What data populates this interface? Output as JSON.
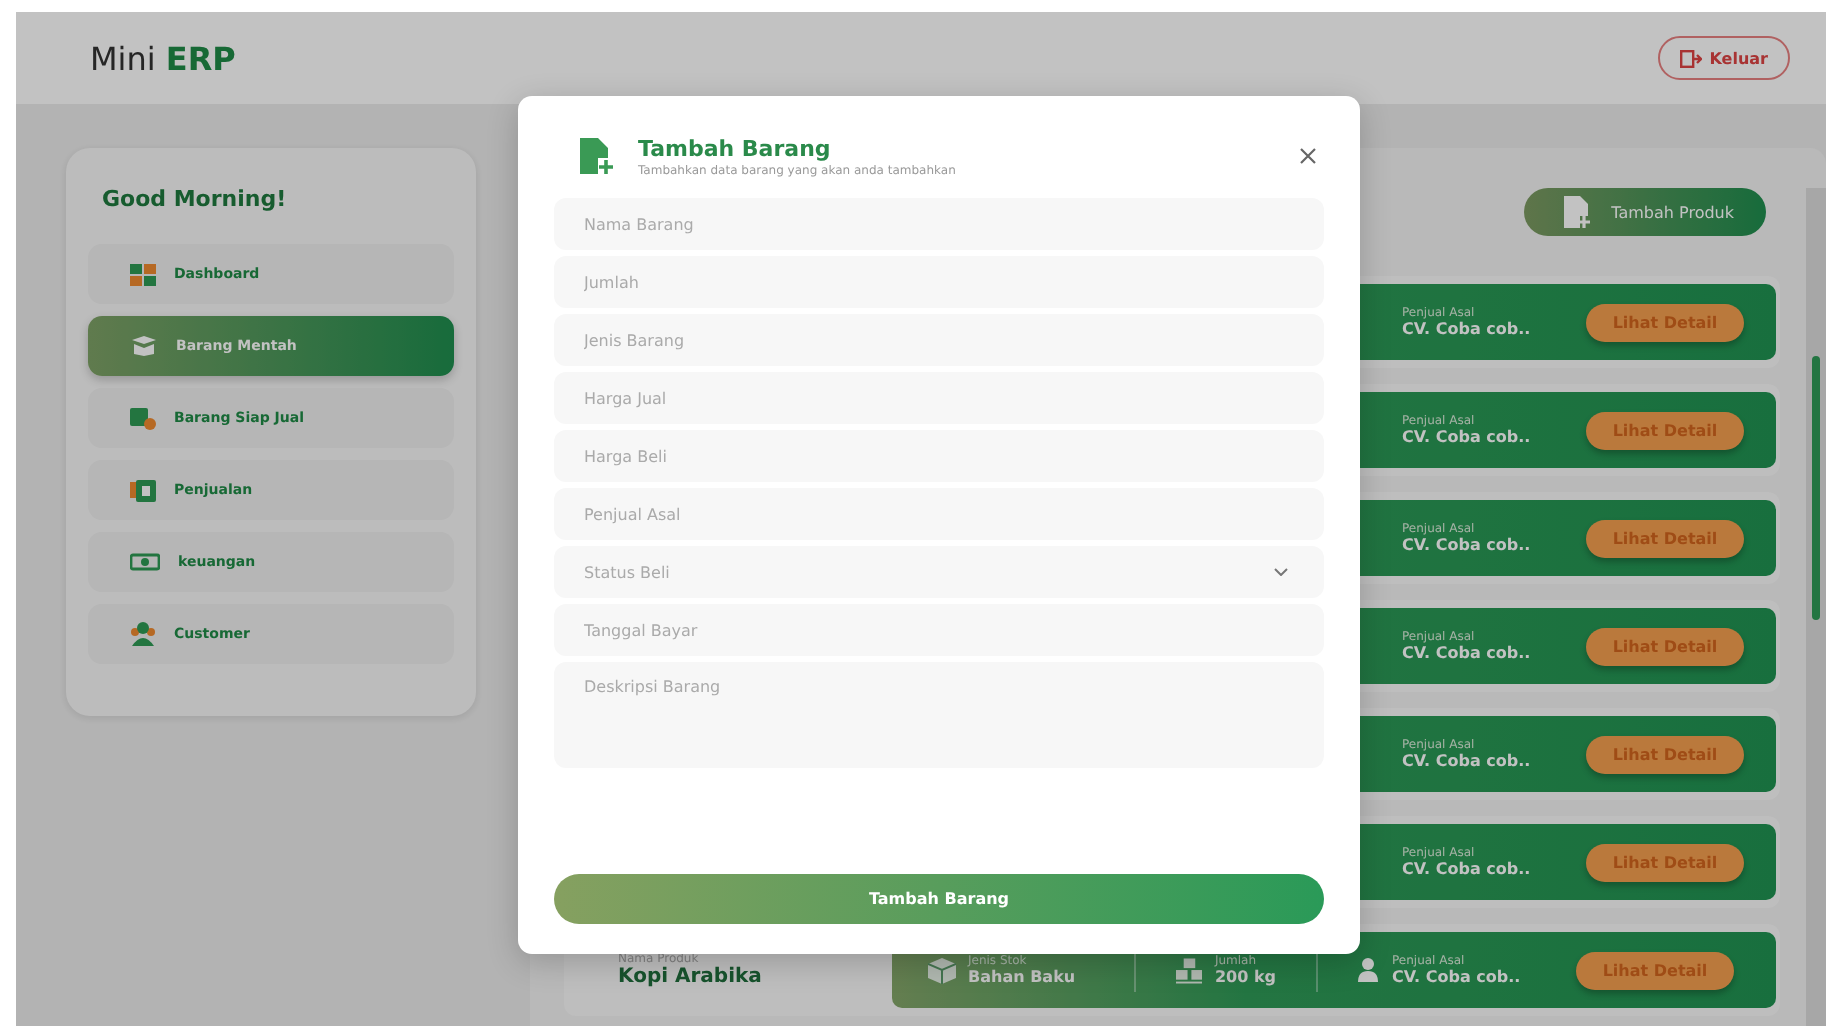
{
  "header": {
    "brand": "Mini **ERP**",
    "logout_button": "Keluar"
  },
  "sidebar": {
    "greeting": "Good Morning!",
    "items": [
      {
        "label": "Dashboard",
        "selected": false
      },
      {
        "label": "Barang Mentah",
        "selected": true
      },
      {
        "label": "Barang Siap Jual",
        "selected": false
      },
      {
        "label": "Penjualan",
        "selected": false
      },
      {
        "label": "keuangan",
        "selected": false
      },
      {
        "label": "Customer",
        "selected": false
      }
    ]
  },
  "main": {
    "add_button": "Tambah Produk",
    "products": [
      {
        "seller_label": "Penjual Asal",
        "seller": "CV. Coba cob..",
        "detail_button": "Lihat Detail"
      },
      {
        "seller_label": "Penjual Asal",
        "seller": "CV. Coba cob..",
        "detail_button": "Lihat Detail"
      },
      {
        "seller_label": "Penjual Asal",
        "seller": "CV. Coba cob..",
        "detail_button": "Lihat Detail"
      },
      {
        "seller_label": "Penjual Asal",
        "seller": "CV. Coba cob..",
        "detail_button": "Lihat Detail"
      },
      {
        "seller_label": "Penjual Asal",
        "seller": "CV. Coba cob..",
        "detail_button": "Lihat Detail"
      },
      {
        "seller_label": "Penjual Asal",
        "seller": "CV. Coba cob..",
        "detail_button": "Lihat Detail"
      },
      {
        "name_label": "Nama Produk",
        "name": "Kopi Arabika",
        "stock_type_label": "Jenis Stok",
        "stock_type": "Bahan Baku",
        "quantity_label": "Jumlah",
        "quantity": "200 kg",
        "seller_label": "Penjual Asal",
        "seller": "CV. Coba cob..",
        "detail_button": "Lihat Detail"
      }
    ]
  },
  "modal": {
    "title": "Tambah Barang",
    "subtitle": "Tambahkan data barang yang akan anda tambahkan",
    "fields": [
      {
        "kind": "text",
        "placeholder": "Nama Barang"
      },
      {
        "kind": "text",
        "placeholder": "Jumlah"
      },
      {
        "kind": "text",
        "placeholder": "Jenis Barang"
      },
      {
        "kind": "text",
        "placeholder": "Harga Jual"
      },
      {
        "kind": "text",
        "placeholder": "Harga Beli"
      },
      {
        "kind": "text",
        "placeholder": "Penjual Asal"
      },
      {
        "kind": "select",
        "placeholder": "Status Beli"
      },
      {
        "kind": "text",
        "placeholder": "Tanggal Bayar"
      },
      {
        "kind": "textarea",
        "placeholder": "Deskripsi Barang"
      }
    ],
    "submit_button": "Tambah Barang"
  }
}
